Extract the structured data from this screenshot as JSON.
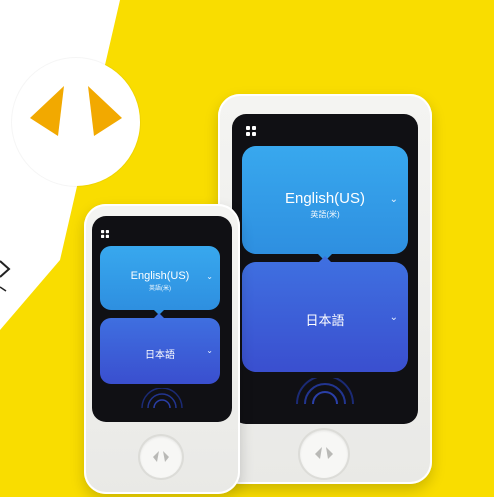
{
  "colors": {
    "brand_yellow": "#f9dd00",
    "logo_orange": "#f2a900",
    "bubble_top": "#2f9fe6",
    "bubble_bottom": "#3f5fd8",
    "screen": "#101014"
  },
  "logo": {
    "icon": "pocketalk-logo-icon"
  },
  "large_device": {
    "top_language": "English(US)",
    "top_language_sub": "英語(米)",
    "bottom_language": "日本語"
  },
  "small_device": {
    "top_language": "English(US)",
    "top_language_sub": "英語(米)",
    "bottom_language": "日本語"
  },
  "icons": {
    "menu": "grid-icon",
    "dropdown": "chevron-down-icon",
    "home": "logo-button-icon",
    "mic": "sound-wave-icon"
  }
}
